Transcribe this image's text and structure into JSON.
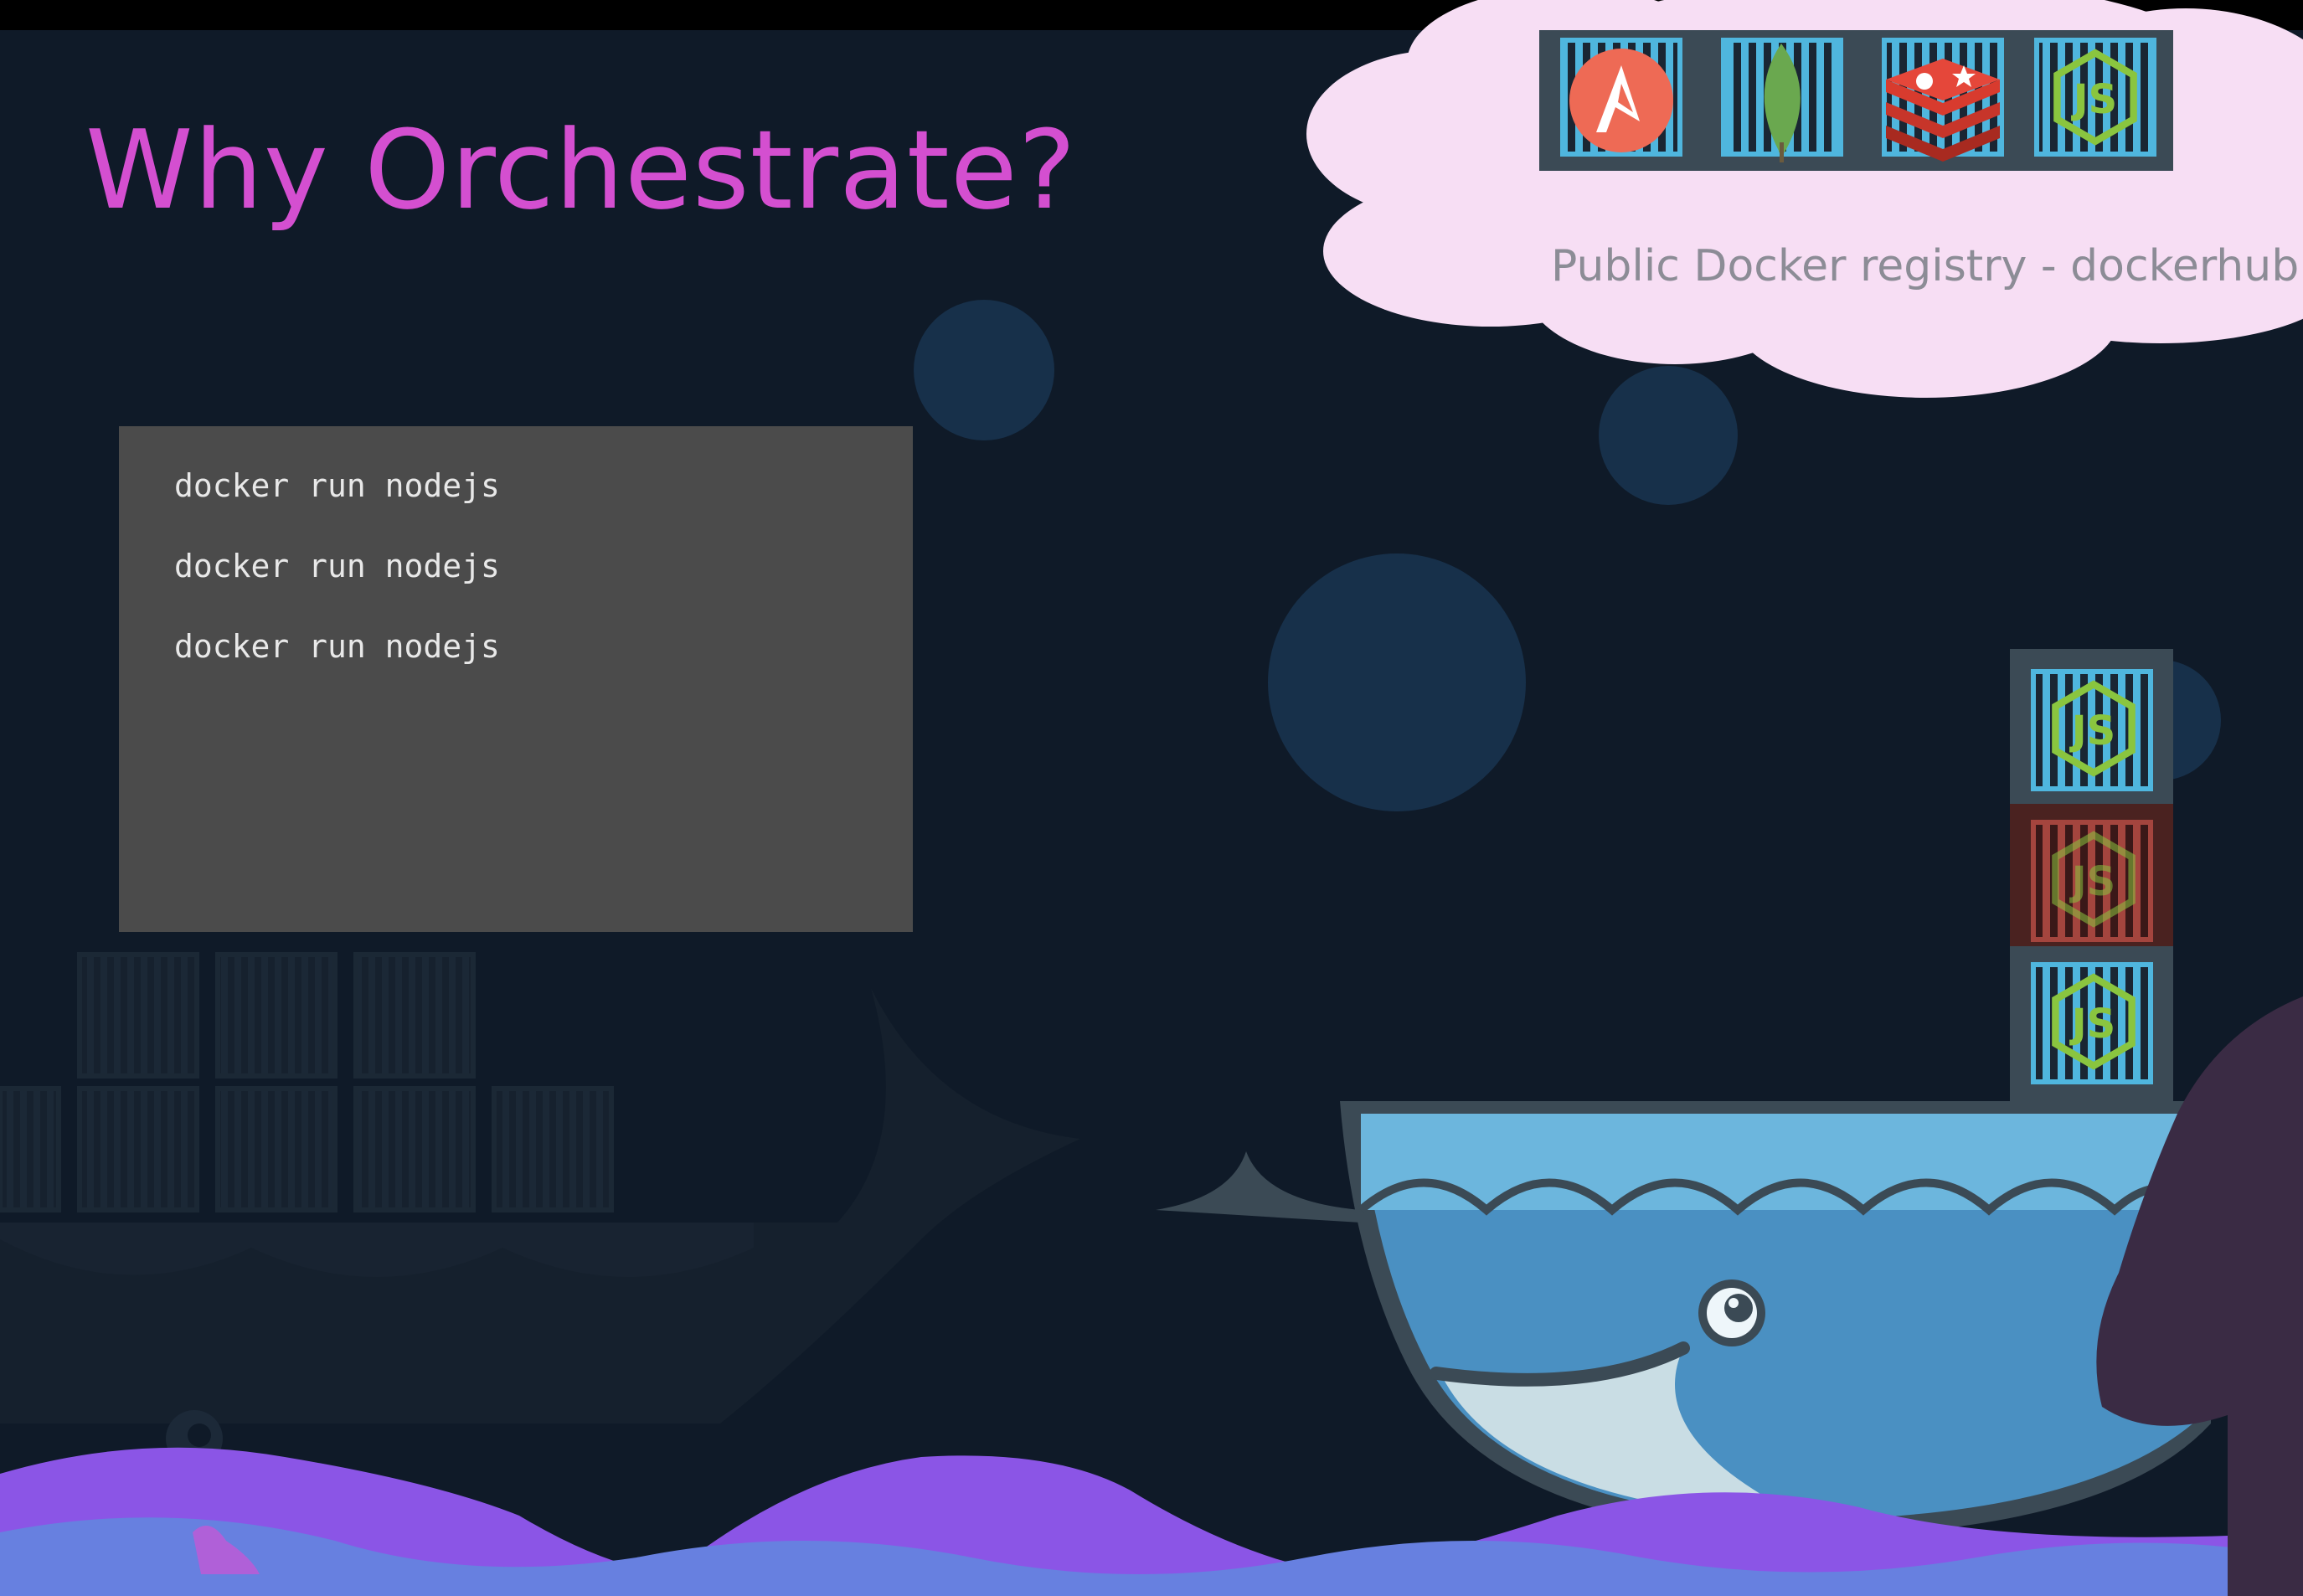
{
  "slide": {
    "title": "Why Orchestrate?",
    "title_color": "#d44fd0"
  },
  "terminal": {
    "commands": [
      "docker run nodejs",
      "docker run nodejs",
      "docker run nodejs"
    ]
  },
  "registry": {
    "label": "Public Docker registry - dockerhub",
    "images": [
      "ansible-icon",
      "mongodb-icon",
      "redis-icon",
      "nodejs-icon"
    ]
  },
  "ship": {
    "container_stack": [
      "nodejs-icon",
      "nodejs-icon",
      "nodejs-icon"
    ]
  },
  "colors": {
    "background": "#0f1a28",
    "whale_blue": "#4a90c2",
    "wave_purple": "#8b55e6",
    "container_blue": "#4fb6de",
    "container_red": "#8a3a36",
    "cloud_pink": "#f7def4"
  }
}
